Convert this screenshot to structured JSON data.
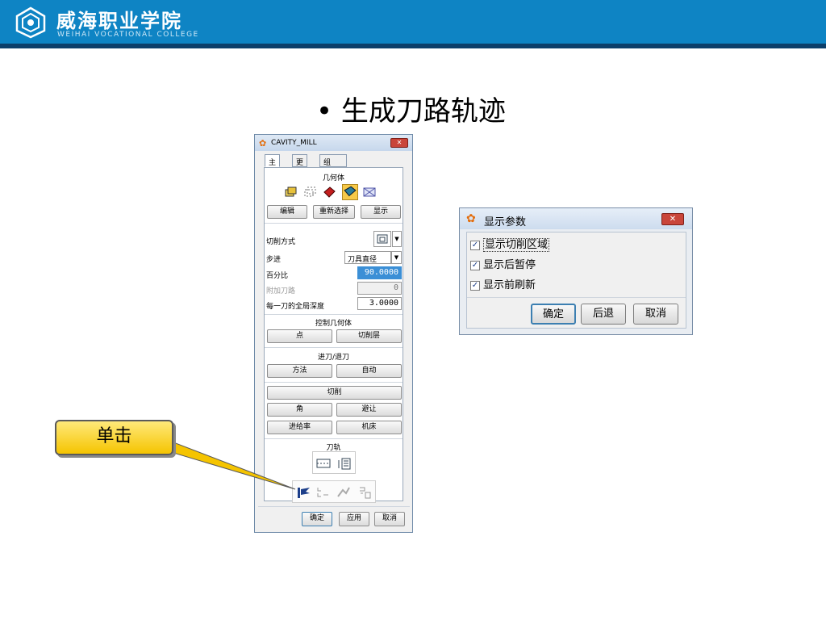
{
  "header": {
    "school_name": "威海职业学院",
    "school_name_en": "WEIHAI VOCATIONAL COLLEGE"
  },
  "slide": {
    "title": "• 生成刀路轨迹"
  },
  "dialog": {
    "title": "CAVITY_MILL",
    "tabs": [
      "主界面",
      "更多",
      "组"
    ],
    "geometry_label": "几何体",
    "edit_button": "编辑",
    "reselect_button": "重新选择",
    "display_button": "显示",
    "cut_pattern_label": "切削方式",
    "stepover_label": "步进",
    "stepover_value": "刀具直径",
    "percent_label": "百分比",
    "percent_value": "90.0000",
    "additional_passes_label": "附加刀路",
    "additional_passes_value": "0",
    "depth_label": "每一刀的全局深度",
    "depth_value": "3.0000",
    "control_geometry_label": "控制几何体",
    "points_button": "点",
    "cut_levels_button": "切削层",
    "engage_retract_label": "进刀/退刀",
    "method_button": "方法",
    "auto_button": "自动",
    "cutting_button": "切削",
    "corner_button": "角",
    "avoidance_button": "避让",
    "feeds_button": "进给率",
    "machine_button": "机床",
    "toolpath_label": "刀轨",
    "ok_button": "确定",
    "apply_button": "应用",
    "cancel_button": "取消"
  },
  "popup": {
    "title": "显示参数",
    "options": [
      {
        "label": "显示切削区域",
        "checked": true
      },
      {
        "label": "显示后暂停",
        "checked": true
      },
      {
        "label": "显示前刷新",
        "checked": true
      }
    ],
    "ok_button": "确定",
    "back_button": "后退",
    "cancel_button": "取消"
  },
  "callout": {
    "text": "单击"
  },
  "colors": {
    "header": "#0e84c4",
    "header_line": "#0c3f6a",
    "callout": "#f5c400",
    "selected": "#3b8fd6"
  }
}
